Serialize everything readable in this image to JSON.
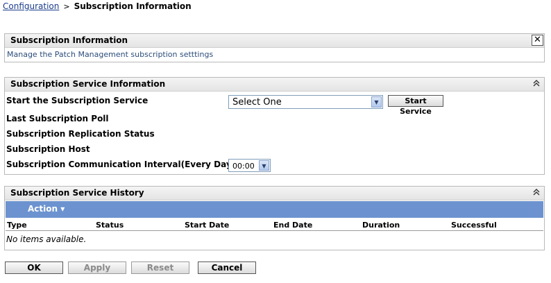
{
  "breadcrumb": {
    "link": "Configuration",
    "separator": ">",
    "current": "Subscription Information"
  },
  "info_panel": {
    "title": "Subscription Information",
    "description": "Manage the Patch Management subscription setttings",
    "close_icon": "✕"
  },
  "service_panel": {
    "title": "Subscription Service Information",
    "collapse_icon": "⌃",
    "rows": {
      "start_service_label": "Start the Subscription Service",
      "last_poll_label": "Last Subscription Poll",
      "replication_status_label": "Subscription Replication Status",
      "host_label": "Subscription Host",
      "interval_label": "Subscription Communication Interval(Every Day at)"
    },
    "service_select_value": "Select One",
    "start_service_button": "Start Service",
    "interval_select_value": "00:00"
  },
  "history_panel": {
    "title": "Subscription Service History",
    "collapse_icon": "⌃",
    "action_label": "Action ▾",
    "columns": [
      "Type",
      "Status",
      "Start Date",
      "End Date",
      "Duration",
      "Successful"
    ],
    "empty_text": "No items available."
  },
  "footer": {
    "ok": "OK",
    "apply": "Apply",
    "reset": "Reset",
    "cancel": "Cancel"
  }
}
